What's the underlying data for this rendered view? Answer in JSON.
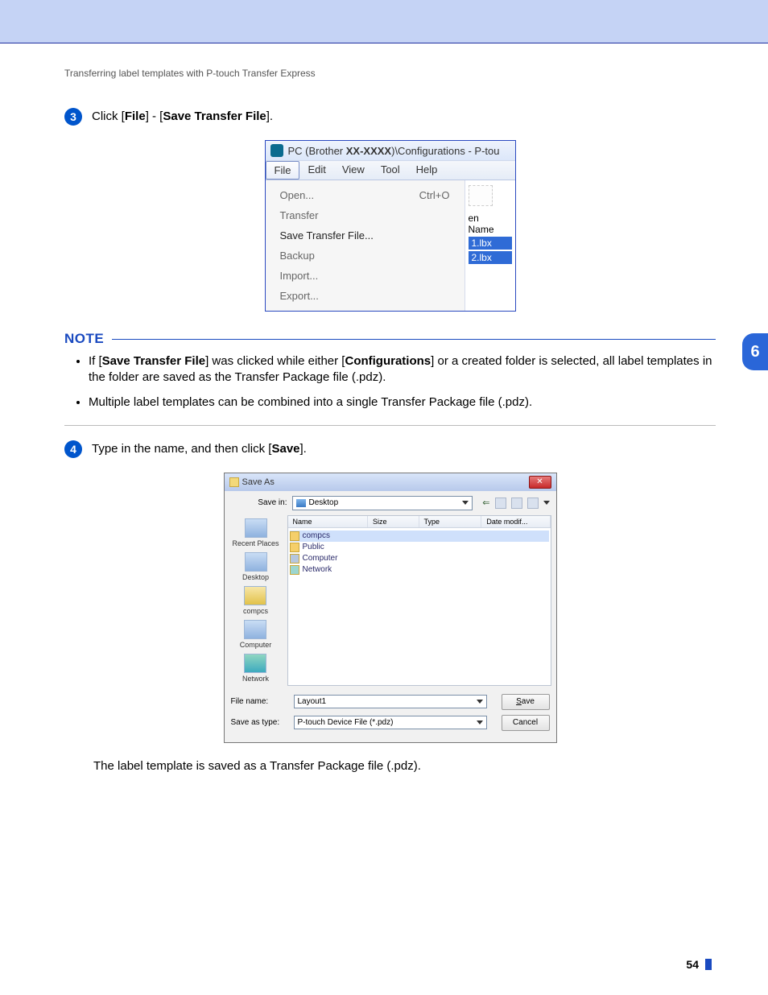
{
  "header": "Transferring label templates with P-touch Transfer Express",
  "side_chapter": "6",
  "step3": {
    "num": "3",
    "prefix": "Click [",
    "file": "File",
    "mid": "] - [",
    "save_tf": "Save Transfer File",
    "suffix": "]."
  },
  "menu_fig": {
    "title_prefix": "PC (Brother ",
    "title_bold": "XX-XXXX",
    "title_suffix": ")\\Configurations - P-tou",
    "menus": {
      "file": "File",
      "edit": "Edit",
      "view": "View",
      "tool": "Tool",
      "help": "Help"
    },
    "items": {
      "open": "Open...",
      "open_sc": "Ctrl+O",
      "transfer": "Transfer",
      "save_tf": "Save Transfer File...",
      "backup": "Backup",
      "import": "Import...",
      "export": "Export..."
    },
    "side": {
      "en": "en",
      "name": "Name",
      "f1": "1.lbx",
      "f2": "2.lbx"
    }
  },
  "note": {
    "title": "NOTE",
    "b1_a": "If [",
    "b1_b": "Save Transfer File",
    "b1_c": "] was clicked while either [",
    "b1_d": "Configurations",
    "b1_e": "] or a created folder is selected, all label templates in the folder are saved as the Transfer Package file (.pdz).",
    "b2": "Multiple label templates can be combined into a single Transfer Package file (.pdz)."
  },
  "step4": {
    "num": "4",
    "prefix": "Type in the name, and then click [",
    "save": "Save",
    "suffix": "]."
  },
  "saveas": {
    "title": "Save As",
    "savein_label": "Save in:",
    "savein_value": "Desktop",
    "cols": {
      "name": "Name",
      "size": "Size",
      "type": "Type",
      "date": "Date modif..."
    },
    "places": {
      "recent": "Recent Places",
      "desktop": "Desktop",
      "compcs": "compcs",
      "computer": "Computer",
      "network": "Network"
    },
    "items": {
      "compcs": "compcs",
      "public": "Public",
      "computer": "Computer",
      "network": "Network"
    },
    "filename_label": "File name:",
    "filename_value": "Layout1",
    "type_label": "Save as type:",
    "type_value": "P-touch Device File (*.pdz)",
    "save_btn": "Save",
    "cancel_btn": "Cancel"
  },
  "after": "The label template is saved as a Transfer Package file (.pdz).",
  "page_number": "54"
}
